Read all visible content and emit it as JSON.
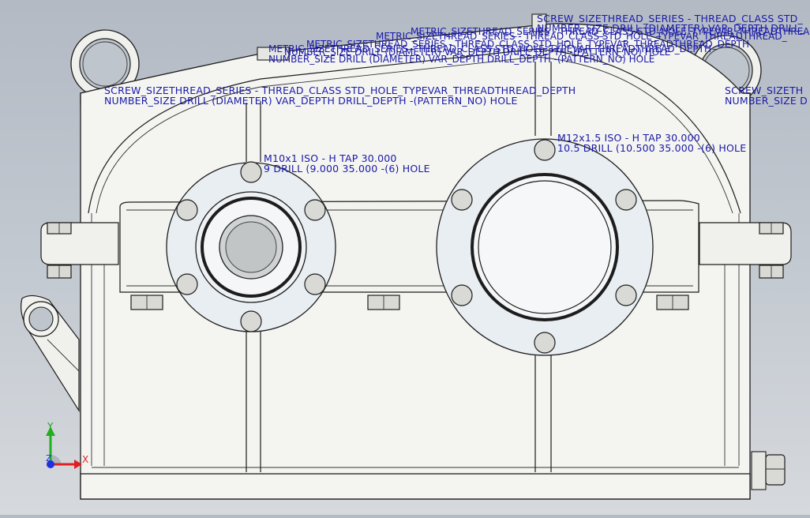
{
  "viewport": {
    "annotations": {
      "top_right_1": "SCREW_SIZETHREAD_SERIES - THREAD_CLASS STD_",
      "top_right_2": "NUMBER_SIZE DRILL (DIAMETER) VAR_DEPTH DRILL_",
      "top_metric_1": "METRIC_SIZETHREAD_SERIES - THREAD_CLASS STD_HOLE_TYPEVAR_THREADTHREAD_",
      "top_metric_2": "NUMBER_SIZE DRILL (DIAMETER) VAR_DEPTH DRILL_DEPTH -(PATTERN_NO) HOLE",
      "top_metric_3": "METRIC_SIZETHREAD_SERIES - THREAD_CLASS STD_HOLE_TYPEVAR_THREADTHREAD_DEPTH",
      "top_metric_4": "NUMBER_SIZE DRILL (DIAMETER) VAR_DEPTH DRILL_DEPTH -(PATTERN_NO) HOLE",
      "left_1": "SCREW_SIZETHREAD_SERIES - THREAD_CLASS STD_HOLE_TYPEVAR_THREADTHREAD_DEPTH",
      "left_2": "NUMBER_SIZE DRILL (DIAMETER) VAR_DEPTH DRILL_DEPTH -(PATTERN_NO) HOLE",
      "right_edge_1": "SCREW_SIZETH",
      "right_edge_2": "NUMBER_SIZE D",
      "hole_left_1": "M10x1 ISO - H TAP 30.000",
      "hole_left_2": "9 DRILL (9.000  35.000 -(6) HOLE",
      "hole_right_1": "M12x1.5 ISO - H TAP 30.000",
      "hole_right_2": "10.5 DRILL (10.500  35.000 -(6) HOLE"
    },
    "triad": {
      "x_label": "X",
      "y_label": "Y",
      "z_label": "Z",
      "x_color": "#e02020",
      "y_color": "#20b020",
      "z_color": "#2030e0"
    }
  }
}
